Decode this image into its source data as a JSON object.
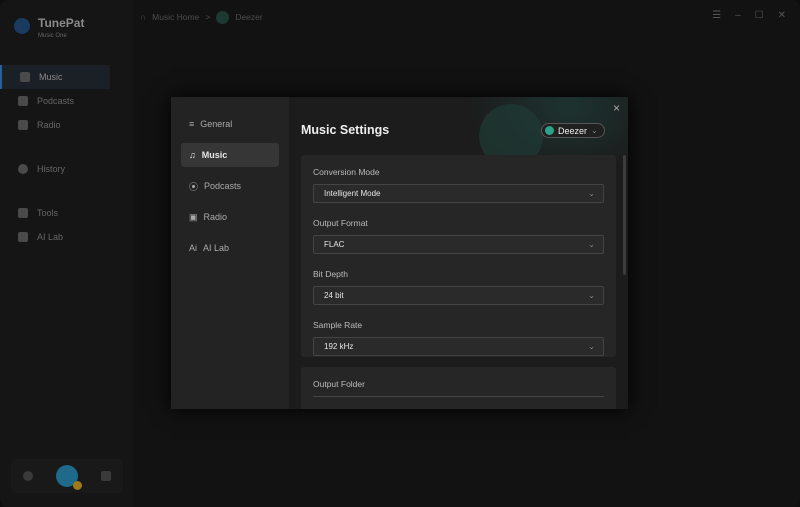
{
  "app": {
    "name": "TunePat",
    "subtitle": "Music One"
  },
  "sidebar": {
    "items": [
      {
        "label": "Music"
      },
      {
        "label": "Podcasts"
      },
      {
        "label": "Radio"
      },
      {
        "label": "History"
      },
      {
        "label": "Tools"
      },
      {
        "label": "AI Lab"
      }
    ]
  },
  "breadcrumb": {
    "home": "Music Home",
    "separator": ">",
    "current": "Deezer"
  },
  "modal": {
    "nav": [
      {
        "label": "General"
      },
      {
        "label": "Music"
      },
      {
        "label": "Podcasts"
      },
      {
        "label": "Radio"
      },
      {
        "label": "AI Lab"
      }
    ],
    "title": "Music Settings",
    "service": "Deezer",
    "close": "×",
    "fields": [
      {
        "label": "Conversion Mode",
        "value": "Intelligent Mode"
      },
      {
        "label": "Output Format",
        "value": "FLAC"
      },
      {
        "label": "Bit Depth",
        "value": "24 bit"
      },
      {
        "label": "Sample Rate",
        "value": "192 kHz"
      }
    ],
    "output_folder_label": "Output Folder"
  },
  "colors": {
    "accent": "#2a5f9a",
    "deezer": "#2aa38a"
  }
}
